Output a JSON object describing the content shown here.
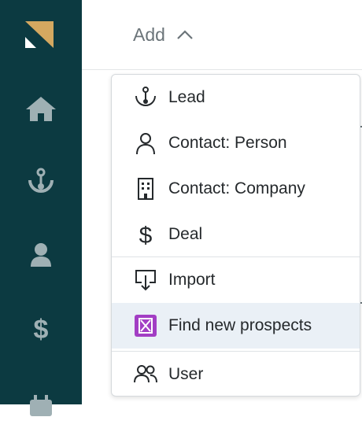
{
  "header": {
    "add_label": "Add"
  },
  "sidebar": {
    "items": [
      {
        "name": "home",
        "icon": "home-icon"
      },
      {
        "name": "leads",
        "icon": "anchor-icon"
      },
      {
        "name": "contacts",
        "icon": "person-icon"
      },
      {
        "name": "deals",
        "icon": "dollar-icon"
      },
      {
        "name": "calendar",
        "icon": "calendar-icon"
      }
    ]
  },
  "add_menu": {
    "items": [
      {
        "label": "Lead",
        "icon": "anchor-icon"
      },
      {
        "label": "Contact: Person",
        "icon": "person-outline-icon"
      },
      {
        "label": "Contact: Company",
        "icon": "building-icon"
      },
      {
        "label": "Deal",
        "icon": "dollar-icon"
      },
      {
        "label": "Import",
        "icon": "import-icon"
      },
      {
        "label": "Find new prospects",
        "icon": "prospects-icon",
        "highlighted": true
      },
      {
        "label": "User",
        "icon": "users-icon"
      }
    ]
  },
  "colors": {
    "sidebar_bg": "#0c3a41",
    "sidebar_icon": "#9fb0b4",
    "logo_gold": "#d4a860",
    "menu_highlight": "#eaf0f6",
    "prospects_purple": "#a23ec4",
    "text": "#25292c",
    "muted_text": "#6b7479"
  }
}
